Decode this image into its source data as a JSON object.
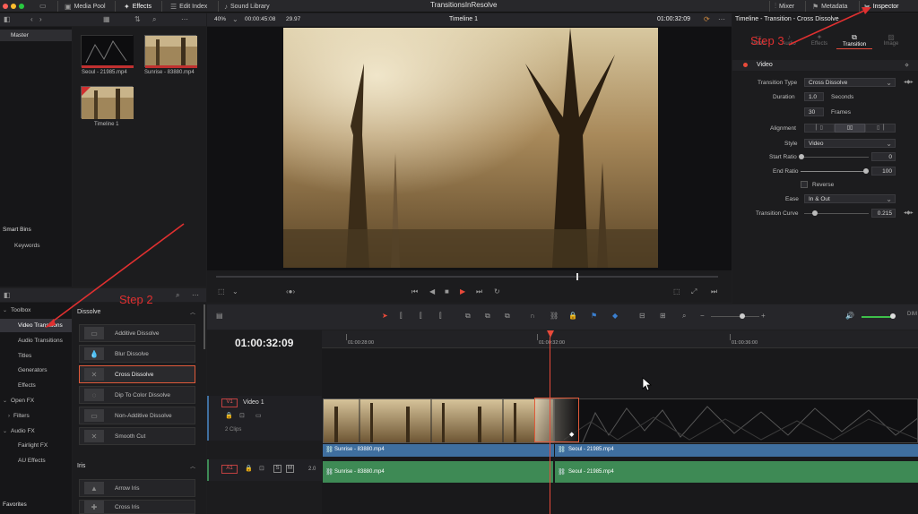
{
  "topbar": {
    "media_pool": "Media Pool",
    "effects": "Effects",
    "edit_index": "Edit Index",
    "sound_library": "Sound Library",
    "project_title": "TransitionsInResolve",
    "mixer": "Mixer",
    "metadata": "Metadata",
    "inspector": "Inspector"
  },
  "mediapool": {
    "master": "Master",
    "clips": [
      {
        "name": "Seoul - 21985.mp4"
      },
      {
        "name": "Sunrise - 83880.mp4"
      },
      {
        "name": "Timeline 1"
      }
    ],
    "smart_bins": "Smart Bins",
    "keywords": "Keywords"
  },
  "viewer": {
    "zoom": "40%",
    "timecode_left": "00:00:45:08",
    "fps": "29.97",
    "timeline_name": "Timeline 1",
    "timecode_right": "01:00:32:09"
  },
  "inspector": {
    "title": "Timeline - Transition - Cross Dissolve",
    "tabs": [
      "Video",
      "Audio",
      "Effects",
      "Transition",
      "Image"
    ],
    "section": "Video",
    "transition_type_label": "Transition Type",
    "transition_type_value": "Cross Dissolve",
    "duration_label": "Duration",
    "duration_seconds": "1.0",
    "seconds_unit": "Seconds",
    "duration_frames": "30",
    "frames_unit": "Frames",
    "alignment_label": "Alignment",
    "style_label": "Style",
    "style_value": "Video",
    "start_ratio_label": "Start Ratio",
    "start_ratio_value": "0",
    "end_ratio_label": "End Ratio",
    "end_ratio_value": "100",
    "reverse_label": "Reverse",
    "ease_label": "Ease",
    "ease_value": "In & Out",
    "curve_label": "Transition Curve",
    "curve_value": "0.215"
  },
  "effects_sidebar": {
    "items": [
      {
        "label": "Toolbox"
      },
      {
        "label": "Video Transitions"
      },
      {
        "label": "Audio Transitions"
      },
      {
        "label": "Titles"
      },
      {
        "label": "Generators"
      },
      {
        "label": "Effects"
      },
      {
        "label": "Open FX"
      },
      {
        "label": "Filters"
      },
      {
        "label": "Audio FX"
      },
      {
        "label": "Fairlight FX"
      },
      {
        "label": "AU Effects"
      }
    ],
    "favorites": "Favorites"
  },
  "effects_list": {
    "dissolve_header": "Dissolve",
    "dissolves": [
      {
        "label": "Additive Dissolve"
      },
      {
        "label": "Blur Dissolve"
      },
      {
        "label": "Cross Dissolve"
      },
      {
        "label": "Dip To Color Dissolve"
      },
      {
        "label": "Non-Additive Dissolve"
      },
      {
        "label": "Smooth Cut"
      }
    ],
    "iris_header": "Iris",
    "iris": [
      {
        "label": "Arrow Iris"
      },
      {
        "label": "Cross Iris"
      }
    ]
  },
  "timeline": {
    "timecode": "01:00:32:09",
    "ruler": [
      "01:00:28:00",
      "01:00:32:00",
      "01:00:36:00"
    ],
    "v1_badge": "V1",
    "video_track_name": "Video 1",
    "video_clip_count": "2 Clips",
    "a1_badge": "A1",
    "audio_level": "2.0",
    "clips": {
      "sunrise_video": "Sunrise - 83880.mp4",
      "seoul_video": "Seoul - 21985.mp4",
      "sunrise_audio": "Sunrise - 83880.mp4",
      "seoul_audio": "Seoul - 21985.mp4"
    }
  },
  "annotations": {
    "step2": "Step 2",
    "step3": "Step 3"
  },
  "colors": {
    "accent_red": "#e03030",
    "video_clip_blue": "#3f6f9f",
    "audio_clip_green": "#3e8a55",
    "playhead": "#e84a3a"
  }
}
